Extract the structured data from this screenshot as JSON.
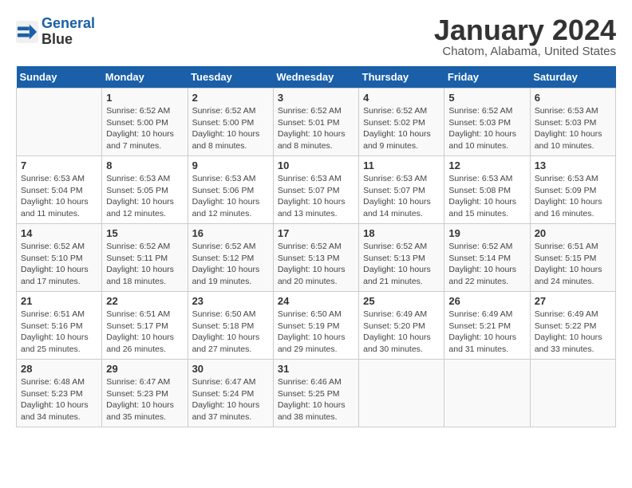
{
  "header": {
    "logo_line1": "General",
    "logo_line2": "Blue",
    "month": "January 2024",
    "location": "Chatom, Alabama, United States"
  },
  "weekdays": [
    "Sunday",
    "Monday",
    "Tuesday",
    "Wednesday",
    "Thursday",
    "Friday",
    "Saturday"
  ],
  "weeks": [
    [
      {
        "day": "",
        "sunrise": "",
        "sunset": "",
        "daylight": ""
      },
      {
        "day": "1",
        "sunrise": "Sunrise: 6:52 AM",
        "sunset": "Sunset: 5:00 PM",
        "daylight": "Daylight: 10 hours and 7 minutes."
      },
      {
        "day": "2",
        "sunrise": "Sunrise: 6:52 AM",
        "sunset": "Sunset: 5:00 PM",
        "daylight": "Daylight: 10 hours and 8 minutes."
      },
      {
        "day": "3",
        "sunrise": "Sunrise: 6:52 AM",
        "sunset": "Sunset: 5:01 PM",
        "daylight": "Daylight: 10 hours and 8 minutes."
      },
      {
        "day": "4",
        "sunrise": "Sunrise: 6:52 AM",
        "sunset": "Sunset: 5:02 PM",
        "daylight": "Daylight: 10 hours and 9 minutes."
      },
      {
        "day": "5",
        "sunrise": "Sunrise: 6:52 AM",
        "sunset": "Sunset: 5:03 PM",
        "daylight": "Daylight: 10 hours and 10 minutes."
      },
      {
        "day": "6",
        "sunrise": "Sunrise: 6:53 AM",
        "sunset": "Sunset: 5:03 PM",
        "daylight": "Daylight: 10 hours and 10 minutes."
      }
    ],
    [
      {
        "day": "7",
        "sunrise": "Sunrise: 6:53 AM",
        "sunset": "Sunset: 5:04 PM",
        "daylight": "Daylight: 10 hours and 11 minutes."
      },
      {
        "day": "8",
        "sunrise": "Sunrise: 6:53 AM",
        "sunset": "Sunset: 5:05 PM",
        "daylight": "Daylight: 10 hours and 12 minutes."
      },
      {
        "day": "9",
        "sunrise": "Sunrise: 6:53 AM",
        "sunset": "Sunset: 5:06 PM",
        "daylight": "Daylight: 10 hours and 12 minutes."
      },
      {
        "day": "10",
        "sunrise": "Sunrise: 6:53 AM",
        "sunset": "Sunset: 5:07 PM",
        "daylight": "Daylight: 10 hours and 13 minutes."
      },
      {
        "day": "11",
        "sunrise": "Sunrise: 6:53 AM",
        "sunset": "Sunset: 5:07 PM",
        "daylight": "Daylight: 10 hours and 14 minutes."
      },
      {
        "day": "12",
        "sunrise": "Sunrise: 6:53 AM",
        "sunset": "Sunset: 5:08 PM",
        "daylight": "Daylight: 10 hours and 15 minutes."
      },
      {
        "day": "13",
        "sunrise": "Sunrise: 6:53 AM",
        "sunset": "Sunset: 5:09 PM",
        "daylight": "Daylight: 10 hours and 16 minutes."
      }
    ],
    [
      {
        "day": "14",
        "sunrise": "Sunrise: 6:52 AM",
        "sunset": "Sunset: 5:10 PM",
        "daylight": "Daylight: 10 hours and 17 minutes."
      },
      {
        "day": "15",
        "sunrise": "Sunrise: 6:52 AM",
        "sunset": "Sunset: 5:11 PM",
        "daylight": "Daylight: 10 hours and 18 minutes."
      },
      {
        "day": "16",
        "sunrise": "Sunrise: 6:52 AM",
        "sunset": "Sunset: 5:12 PM",
        "daylight": "Daylight: 10 hours and 19 minutes."
      },
      {
        "day": "17",
        "sunrise": "Sunrise: 6:52 AM",
        "sunset": "Sunset: 5:13 PM",
        "daylight": "Daylight: 10 hours and 20 minutes."
      },
      {
        "day": "18",
        "sunrise": "Sunrise: 6:52 AM",
        "sunset": "Sunset: 5:13 PM",
        "daylight": "Daylight: 10 hours and 21 minutes."
      },
      {
        "day": "19",
        "sunrise": "Sunrise: 6:52 AM",
        "sunset": "Sunset: 5:14 PM",
        "daylight": "Daylight: 10 hours and 22 minutes."
      },
      {
        "day": "20",
        "sunrise": "Sunrise: 6:51 AM",
        "sunset": "Sunset: 5:15 PM",
        "daylight": "Daylight: 10 hours and 24 minutes."
      }
    ],
    [
      {
        "day": "21",
        "sunrise": "Sunrise: 6:51 AM",
        "sunset": "Sunset: 5:16 PM",
        "daylight": "Daylight: 10 hours and 25 minutes."
      },
      {
        "day": "22",
        "sunrise": "Sunrise: 6:51 AM",
        "sunset": "Sunset: 5:17 PM",
        "daylight": "Daylight: 10 hours and 26 minutes."
      },
      {
        "day": "23",
        "sunrise": "Sunrise: 6:50 AM",
        "sunset": "Sunset: 5:18 PM",
        "daylight": "Daylight: 10 hours and 27 minutes."
      },
      {
        "day": "24",
        "sunrise": "Sunrise: 6:50 AM",
        "sunset": "Sunset: 5:19 PM",
        "daylight": "Daylight: 10 hours and 29 minutes."
      },
      {
        "day": "25",
        "sunrise": "Sunrise: 6:49 AM",
        "sunset": "Sunset: 5:20 PM",
        "daylight": "Daylight: 10 hours and 30 minutes."
      },
      {
        "day": "26",
        "sunrise": "Sunrise: 6:49 AM",
        "sunset": "Sunset: 5:21 PM",
        "daylight": "Daylight: 10 hours and 31 minutes."
      },
      {
        "day": "27",
        "sunrise": "Sunrise: 6:49 AM",
        "sunset": "Sunset: 5:22 PM",
        "daylight": "Daylight: 10 hours and 33 minutes."
      }
    ],
    [
      {
        "day": "28",
        "sunrise": "Sunrise: 6:48 AM",
        "sunset": "Sunset: 5:23 PM",
        "daylight": "Daylight: 10 hours and 34 minutes."
      },
      {
        "day": "29",
        "sunrise": "Sunrise: 6:47 AM",
        "sunset": "Sunset: 5:23 PM",
        "daylight": "Daylight: 10 hours and 35 minutes."
      },
      {
        "day": "30",
        "sunrise": "Sunrise: 6:47 AM",
        "sunset": "Sunset: 5:24 PM",
        "daylight": "Daylight: 10 hours and 37 minutes."
      },
      {
        "day": "31",
        "sunrise": "Sunrise: 6:46 AM",
        "sunset": "Sunset: 5:25 PM",
        "daylight": "Daylight: 10 hours and 38 minutes."
      },
      {
        "day": "",
        "sunrise": "",
        "sunset": "",
        "daylight": ""
      },
      {
        "day": "",
        "sunrise": "",
        "sunset": "",
        "daylight": ""
      },
      {
        "day": "",
        "sunrise": "",
        "sunset": "",
        "daylight": ""
      }
    ]
  ]
}
